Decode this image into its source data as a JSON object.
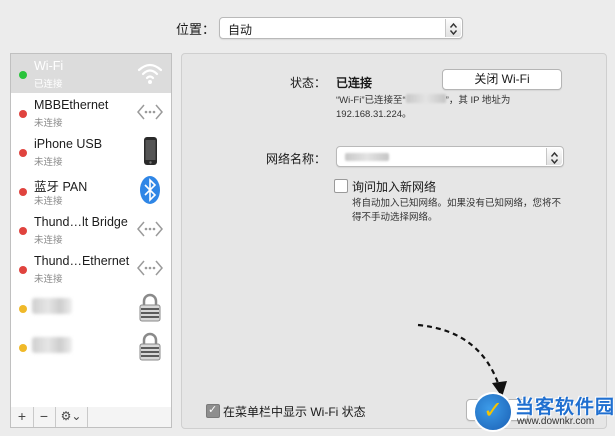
{
  "location": {
    "label": "位置：",
    "value": "自动"
  },
  "sidebar": {
    "services": [
      {
        "name": "Wi-Fi",
        "status": "已连接",
        "dot": "green",
        "icon": "wifi-icon",
        "selected": true
      },
      {
        "name": "MBBEthernet",
        "status": "未连接",
        "dot": "red",
        "icon": "ethernet-arrows-icon"
      },
      {
        "name": "iPhone USB",
        "status": "未连接",
        "dot": "red",
        "icon": "iphone-icon"
      },
      {
        "name": "蓝牙 PAN",
        "status": "未连接",
        "dot": "red",
        "icon": "bluetooth-icon"
      },
      {
        "name": "Thund…lt Bridge",
        "status": "未连接",
        "dot": "red",
        "icon": "ethernet-arrows-icon"
      },
      {
        "name": "Thund…Ethernet",
        "status": "未连接",
        "dot": "red",
        "icon": "ethernet-arrows-icon"
      },
      {
        "dot": "yellow",
        "icon": "vpn-lock-icon"
      },
      {
        "dot": "yellow",
        "icon": "vpn-lock-icon"
      }
    ],
    "toolbar": {
      "add": "+",
      "remove": "−",
      "gear": "⚙︎⌄"
    }
  },
  "detail": {
    "status_label": "状态：",
    "status_value": "已连接",
    "toggle_button": "关闭 Wi-Fi",
    "status_desc_prefix": "“Wi-Fi”已连接至“",
    "status_desc_suffix": "”，其 IP 地址为",
    "ip_line": "192.168.31.224。",
    "network_name_label": "网络名称：",
    "ask_join_label": "询问加入新网络",
    "ask_join_desc_1": "将自动加入已知网络。如果没有已知网络，您将不",
    "ask_join_desc_2": "得不手动选择网络。",
    "show_menubar_label": "在菜单栏中显示 Wi-Fi 状态"
  },
  "watermark": {
    "cn": "当客软件园",
    "url": "www.downkr.com"
  }
}
